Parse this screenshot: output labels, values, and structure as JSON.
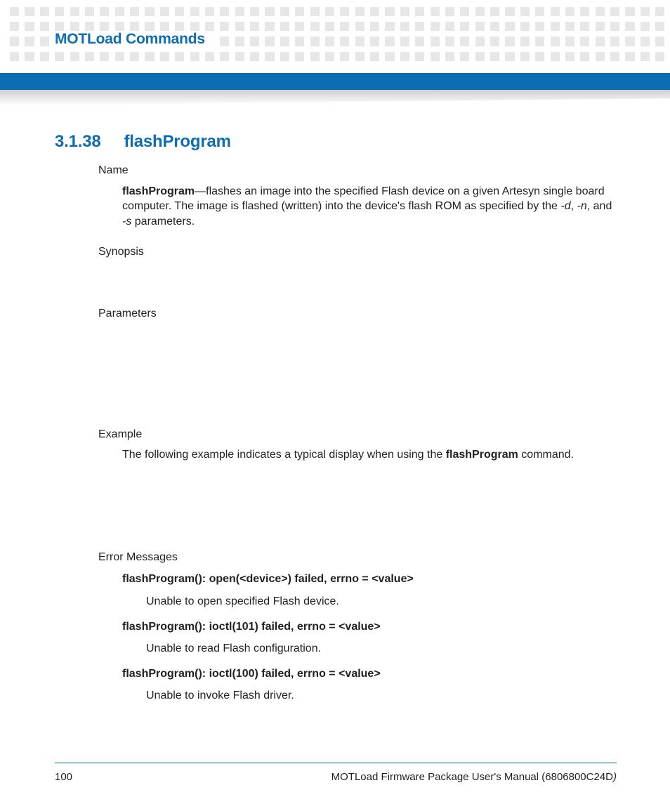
{
  "header": {
    "chapter_title": "MOTLoad Commands"
  },
  "section": {
    "number": "3.1.38",
    "title": "flashProgram"
  },
  "labels": {
    "name": "Name",
    "synopsis": "Synopsis",
    "parameters": "Parameters",
    "example": "Example",
    "errors": "Error Messages"
  },
  "name_block": {
    "cmd": "flashProgram",
    "desc_1": "—flashes an image into the specified Flash device on a given Artesyn single board computer. The image is flashed (written) into the device's flash ROM as specified by the ",
    "opt_d": "-d",
    "sep1": ", ",
    "opt_n": "-n",
    "sep2": ", and ",
    "opt_s": "-s",
    "desc_2": " parameters."
  },
  "example_block": {
    "intro_1": "The following example indicates a typical display when using the ",
    "cmd": "flashProgram",
    "intro_2": " command."
  },
  "errors": [
    {
      "title": "flashProgram(): open(<device>) failed, errno = <value>",
      "desc": "Unable to open specified Flash device."
    },
    {
      "title": "flashProgram(): ioctl(101) failed, errno = <value>",
      "desc": "Unable to read Flash configuration."
    },
    {
      "title": "flashProgram(): ioctl(100) failed, errno = <value>",
      "desc": "Unable to invoke Flash driver."
    }
  ],
  "footer": {
    "page": "100",
    "doc_title": "MOTLoad Firmware Package User's Manual (6806800C24D",
    "doc_close": ")"
  }
}
